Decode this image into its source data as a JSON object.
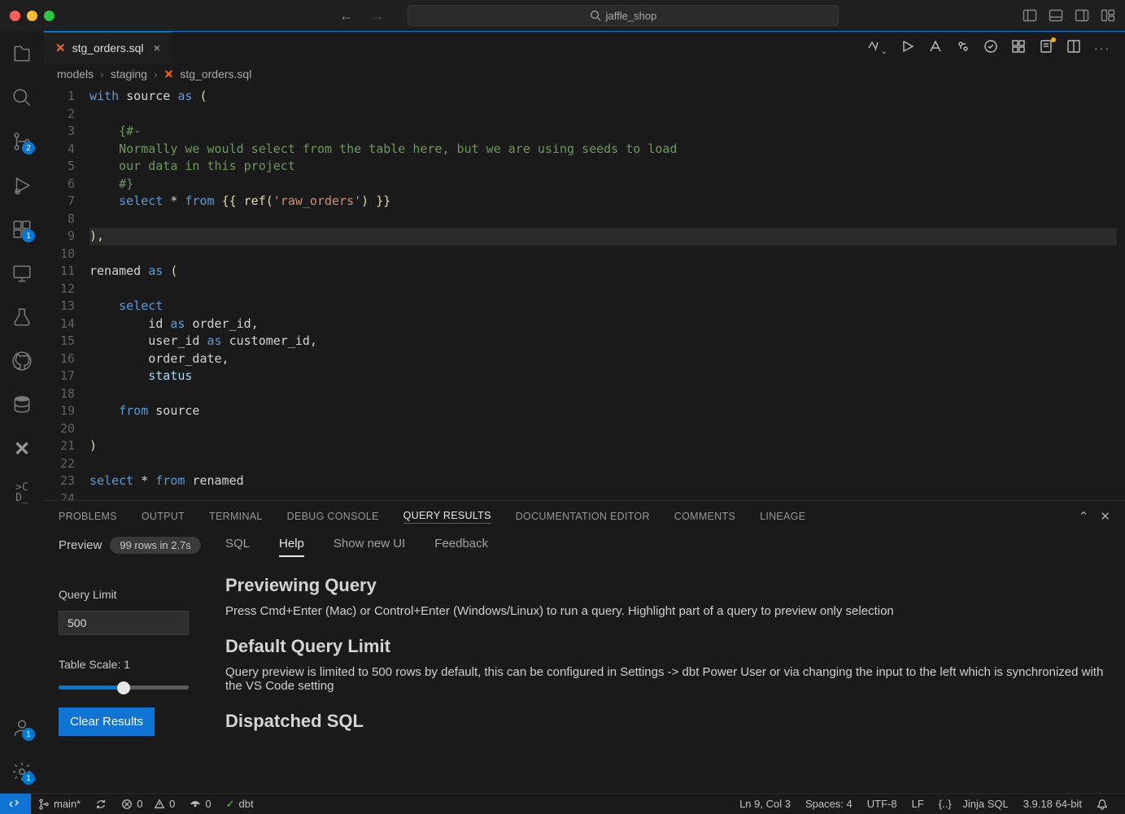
{
  "title_search": "jaffle_shop",
  "activity_badges": {
    "scm": "2",
    "extensions": "1",
    "accounts": "1",
    "settings": "1"
  },
  "tab": {
    "filename": "stg_orders.sql"
  },
  "breadcrumbs": [
    "models",
    "staging",
    "stg_orders.sql"
  ],
  "editor_actions": {},
  "code": {
    "line_count": 24,
    "lines_html": [
      "<span class='kw'>with</span> <span class='pn'>source</span> <span class='kw'>as</span> <span class='jn'>(</span>",
      "",
      "    <span class='cm'>{#-</span>",
      "    <span class='cm'>Normally we would select from the table here, but we are using seeds to load</span>",
      "    <span class='cm'>our data in this project</span>",
      "    <span class='cm'>#}</span>",
      "    <span class='kw'>select</span> <span class='pn'>*</span> <span class='kw'>from</span> <span class='jn'>{{</span> <span class='fn'>ref</span><span class='jn'>(</span><span class='str'>'raw_orders'</span><span class='jn'>)</span> <span class='jn'>}}</span>",
      "",
      "<span class='jn'>)</span><span class='pn'>,</span>",
      "",
      "<span class='pn'>renamed</span> <span class='kw'>as</span> <span class='jn'>(</span>",
      "",
      "    <span class='kw'>select</span>",
      "        <span class='pn'>id</span> <span class='kw'>as</span> <span class='pn'>order_id,</span>",
      "        <span class='pn'>user_id</span> <span class='kw'>as</span> <span class='pn'>customer_id,</span>",
      "        <span class='pn'>order_date,</span>",
      "        <span class='id'>status</span>",
      "",
      "    <span class='kw'>from</span> <span class='pn'>source</span>",
      "",
      "<span class='jn'>)</span>",
      "",
      "<span class='kw'>select</span> <span class='pn'>*</span> <span class='kw'>from</span> <span class='pn'>renamed</span>",
      ""
    ],
    "current_line": 9
  },
  "panel": {
    "tabs": [
      "PROBLEMS",
      "OUTPUT",
      "TERMINAL",
      "DEBUG CONSOLE",
      "QUERY RESULTS",
      "DOCUMENTATION EDITOR",
      "COMMENTS",
      "LINEAGE"
    ],
    "active_tab": "QUERY RESULTS",
    "preview_label": "Preview",
    "preview_badge": "99 rows in 2.7s",
    "subtabs": [
      "SQL",
      "Help",
      "Show new UI",
      "Feedback"
    ],
    "active_subtab": "Help",
    "query_limit_label": "Query Limit",
    "query_limit_value": "500",
    "table_scale_label": "Table Scale: 1",
    "clear_label": "Clear Results",
    "help": {
      "h1": "Previewing Query",
      "p1": "Press Cmd+Enter (Mac) or Control+Enter (Windows/Linux) to run a query. Highlight part of a query to preview only selection",
      "h2": "Default Query Limit",
      "p2": "Query preview is limited to 500 rows by default, this can be configured in Settings -> dbt Power User or via changing the input to the left which is synchronized with the VS Code setting",
      "h3": "Dispatched SQL"
    }
  },
  "status": {
    "branch": "main*",
    "errors": "0",
    "warnings": "0",
    "ports": "0",
    "dbt": "dbt",
    "cursor": "Ln 9, Col 3",
    "spaces": "Spaces: 4",
    "encoding": "UTF-8",
    "eol": "LF",
    "lang": "Jinja SQL",
    "python": "3.9.18 64-bit"
  }
}
